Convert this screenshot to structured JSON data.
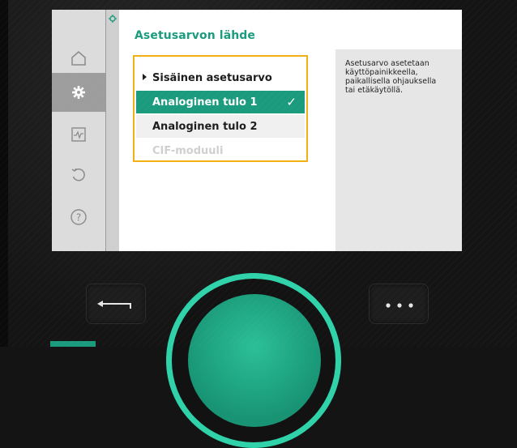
{
  "screen": {
    "title": "Asetusarvon lähde",
    "options": [
      {
        "label": "Sisäinen asetusarvo",
        "state": "current"
      },
      {
        "label": "Analoginen tulo 1",
        "state": "selected",
        "check": "✓"
      },
      {
        "label": "Analoginen tulo 2",
        "state": "normal"
      },
      {
        "label": "CIF-moduuli",
        "state": "disabled"
      }
    ],
    "info_text": "Asetusarvo asetetaan\nkäyttöpainikkeella,\npaikallisella ohjauksella\ntai etäkäytöllä."
  },
  "sidebar": {
    "items": [
      {
        "icon": "home-icon"
      },
      {
        "icon": "gear-icon",
        "active": true
      },
      {
        "icon": "diagnostics-icon"
      },
      {
        "icon": "reset-icon"
      },
      {
        "icon": "help-icon"
      }
    ]
  },
  "hardware": {
    "back_icon": "back-arrow-icon",
    "more_icon": "more-dots-icon",
    "dial": "control-dial"
  },
  "colors": {
    "accent": "#1b9b7e",
    "focus": "#f2b012",
    "dial_ring": "#2fd2a9"
  }
}
